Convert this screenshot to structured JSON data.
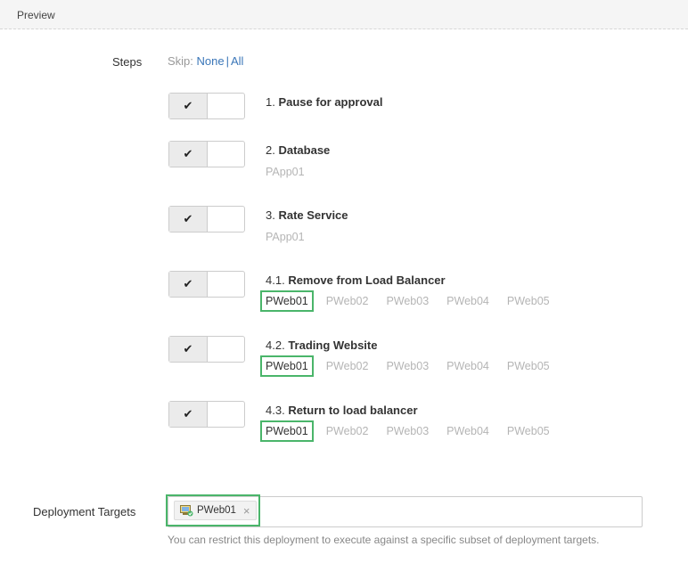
{
  "header": {
    "title": "Preview"
  },
  "steps_section": {
    "label": "Steps",
    "skip_prefix": "Skip:",
    "skip_none": "None",
    "skip_sep": "|",
    "skip_all": "All"
  },
  "steps": [
    {
      "num": "1.",
      "title": "Pause for approval",
      "enabled": true,
      "sub": ""
    },
    {
      "num": "2.",
      "title": "Database",
      "enabled": true,
      "sub": "PApp01"
    },
    {
      "num": "3.",
      "title": "Rate Service",
      "enabled": true,
      "sub": "PApp01"
    },
    {
      "num": "4.1.",
      "title": "Remove from Load Balancer",
      "enabled": true,
      "machines": [
        "PWeb01",
        "PWeb02",
        "PWeb03",
        "PWeb04",
        "PWeb05"
      ],
      "selected": "PWeb01"
    },
    {
      "num": "4.2.",
      "title": "Trading Website",
      "enabled": true,
      "machines": [
        "PWeb01",
        "PWeb02",
        "PWeb03",
        "PWeb04",
        "PWeb05"
      ],
      "selected": "PWeb01"
    },
    {
      "num": "4.3.",
      "title": "Return to load balancer",
      "enabled": true,
      "machines": [
        "PWeb01",
        "PWeb02",
        "PWeb03",
        "PWeb04",
        "PWeb05"
      ],
      "selected": "PWeb01"
    }
  ],
  "toggle_icon": "check-icon",
  "deployment_targets": {
    "label": "Deployment Targets",
    "chip_label": "PWeb01",
    "chip_icon": "server-check-icon",
    "chip_remove": "×",
    "help": "You can restrict this deployment to execute against a specific subset of deployment targets."
  },
  "colors": {
    "link": "#3a76b8",
    "highlight": "#4ab56a",
    "muted": "#b5b5b5"
  }
}
